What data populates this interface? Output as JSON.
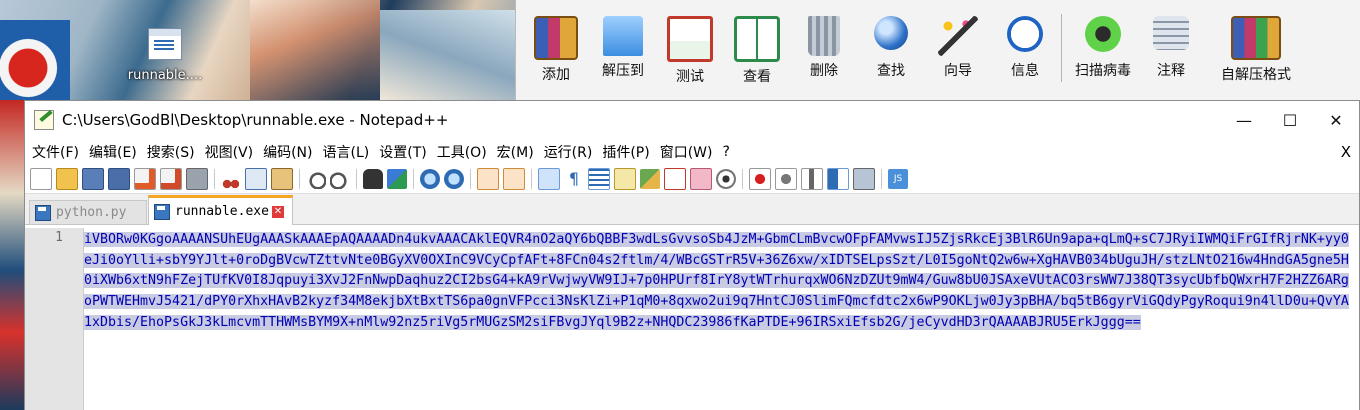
{
  "desktop": {
    "icon_label": "runnable...."
  },
  "archiver": {
    "buttons": [
      {
        "label": "添加",
        "icon": "archive-add-icon"
      },
      {
        "label": "解压到",
        "icon": "extract-folder-icon"
      },
      {
        "label": "测试",
        "icon": "test-clipboard-icon"
      },
      {
        "label": "查看",
        "icon": "view-book-icon"
      },
      {
        "label": "删除",
        "icon": "trash-icon"
      },
      {
        "label": "查找",
        "icon": "magnifier-icon"
      },
      {
        "label": "向导",
        "icon": "wand-icon"
      },
      {
        "label": "信息",
        "icon": "info-icon"
      },
      {
        "label": "扫描病毒",
        "icon": "bug-scan-icon"
      },
      {
        "label": "注释",
        "icon": "comment-icon"
      },
      {
        "label": "自解压格式",
        "icon": "sfx-icon"
      }
    ]
  },
  "notepad": {
    "title": "C:\\Users\\GodBl\\Desktop\\runnable.exe - Notepad++",
    "menu": [
      "文件(F)",
      "编辑(E)",
      "搜索(S)",
      "视图(V)",
      "编码(N)",
      "语言(L)",
      "设置(T)",
      "工具(O)",
      "宏(M)",
      "运行(R)",
      "插件(P)",
      "窗口(W)",
      "?"
    ],
    "menu_close": "X",
    "tabs": [
      {
        "label": "python.py",
        "active": false
      },
      {
        "label": "runnable.exe",
        "active": true
      }
    ],
    "line_number": "1",
    "content": "iVBORw0KGgoAAAANSUhEUgAAASkAAAEpAQAAAADn4ukvAAACAklEQVR4nO2aQY6bQBBF3wdLsGvvsoSb4JzM+GbmCLmBvcwOFpFAMvwsIJ5ZjsRkcEj3BlR6Un9apa+qLmQ+sC7JRyiIWMQiFrGIfRjrNK+yy0eJi0oYlli+sbY9YJlt+0roDgBVcwTZttvNte0BGyXV0OXInC9VCyCpfAFt+8FCn04s2ftlm/4/WBcGSTrR5V+36Z6xw/xIDTSELpsSzt/L0I5goNtQ2w6w+XgHAVB034bUguJH/stzLNtO216w4HndGA5gne5H0iXWb6xtN9hFZejTUfKV0I8Jqpuyi3XvJ2FnNwpDaqhuz2CI2bsG4+kA9rVwjwyVW9IJ+7p0HPUrf8IrY8ytWTrhurqxWO6NzDZUt9mW4/Guw8bU0JSAxeVUtACO3rsWW7J38QT3sycUbfbQWxrH7F2HZZ6ARgoPWTWEHmvJ5421/dPY0rXhxHAvB2kyzf34M8ekjbXtBxtTS6pa0gnVFPcci3NsKlZi+P1qM0+8qxwo2ui9q7HntCJ0SlimFQmcfdtc2x6wP9OKLjw0Jy3pBHA/bq5tB6gyrViGQdyPgyRoqui9n4llD0u+QvYA1xDbis/EhoPsGkJ3kLmcvmTTHWMsBYM9X+nMlw92nz5riVg5rMUGzSM2siFBvgJYql9B2z+NHQDC23986fKaPTDE+96IRSxiEfsb2G/jeCyvdHD3rQAAAABJRU5ErkJggg=="
  }
}
